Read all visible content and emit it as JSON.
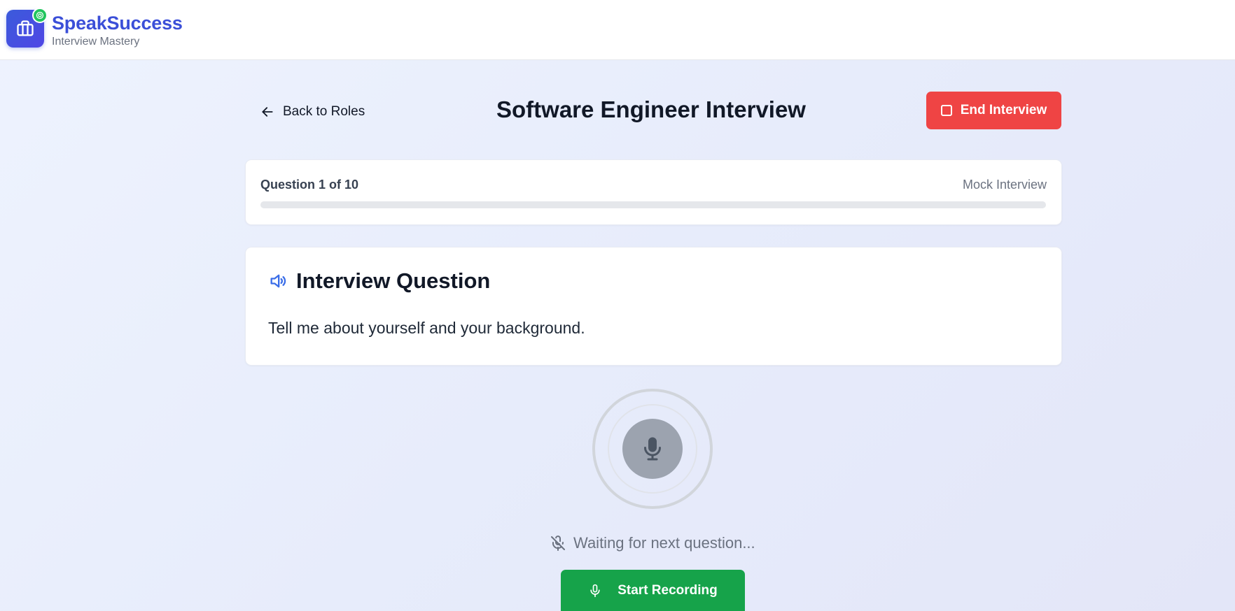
{
  "header": {
    "brand_name": "SpeakSuccess",
    "brand_tagline": "Interview Mastery"
  },
  "nav": {
    "back_label": "Back to Roles",
    "page_title": "Software Engineer Interview",
    "end_label": "End Interview"
  },
  "progress": {
    "question_label": "Question 1 of 10",
    "mode_label": "Mock Interview",
    "fraction": 0
  },
  "question": {
    "heading": "Interview Question",
    "text": "Tell me about yourself and your background."
  },
  "recorder": {
    "status_text": "Waiting for next question...",
    "button_label": "Start Recording"
  },
  "colors": {
    "brand": "#3b4fd8",
    "danger": "#ef4444",
    "success": "#16a34a",
    "accent_icon": "#3b6ee8"
  },
  "icons": {
    "logo": "briefcase-icon",
    "badge": "target-icon",
    "back": "arrow-left-icon",
    "end": "square-icon",
    "question": "speaker-icon",
    "mic": "microphone-icon",
    "status": "mic-off-icon"
  }
}
